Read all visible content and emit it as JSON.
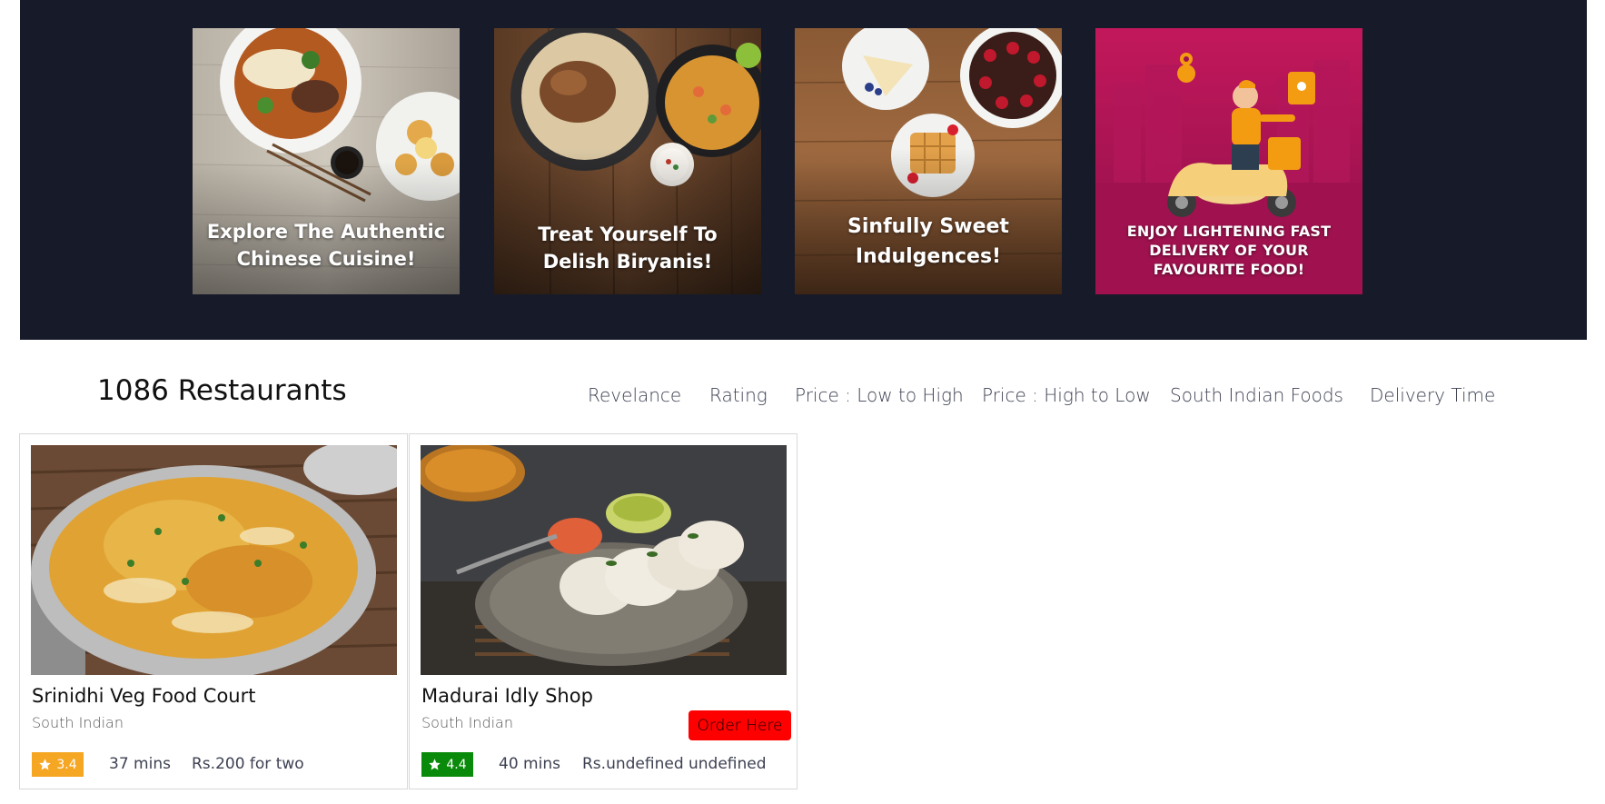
{
  "offers": [
    {
      "caption_line1": "Explore The Authentic",
      "caption_line2": "Chinese Cuisine!"
    },
    {
      "caption_line1": "Treat Yourself To",
      "caption_line2": "Delish Biryanis!"
    },
    {
      "caption_line1": "Sinfully Sweet",
      "caption_line2": "Indulgences!"
    },
    {
      "caption_line1": "ENJOY LIGHTENING FAST",
      "caption_line2": "DELIVERY OF YOUR",
      "caption_line3": "FAVOURITE FOOD!"
    }
  ],
  "listing": {
    "count_label": "1086 Restaurants"
  },
  "sort_options": [
    "Revelance",
    "Rating",
    "Price : Low to High",
    "Price : High to Low",
    "South Indian Foods",
    "Delivery Time"
  ],
  "restaurants": [
    {
      "name": "Srinidhi Veg Food Court",
      "cuisine": "South Indian",
      "rating": "3.4",
      "rating_color": "#f5a623",
      "delivery_time": "37 mins",
      "cost": "Rs.200 for two"
    },
    {
      "name": "Madurai Idly Shop",
      "cuisine": "South Indian",
      "rating": "4.4",
      "rating_color": "#0a8a0a",
      "delivery_time": "40 mins",
      "cost": "Rs.undefined undefined",
      "order_button": "Order Here"
    }
  ],
  "icons": {
    "rating": "star-icon"
  },
  "colors": {
    "banner_bg": "#171a29",
    "order_button": "#ff0000"
  }
}
